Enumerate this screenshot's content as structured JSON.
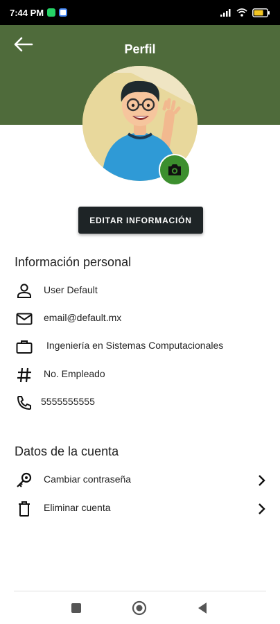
{
  "status_bar": {
    "time": "7:44 PM",
    "battery": "65"
  },
  "header": {
    "title": "Perfil",
    "color": "#4f6b3b"
  },
  "profile": {
    "edit_label": "EDITAR INFORMACIÓN",
    "camera_color": "#3c8f2e"
  },
  "personal": {
    "title": "Información personal",
    "items": [
      {
        "icon": "person-icon",
        "label": "User Default"
      },
      {
        "icon": "mail-icon",
        "label": "email@default.mx"
      },
      {
        "icon": "briefcase-icon",
        "label": "Ingeniería en Sistemas Computacionales"
      },
      {
        "icon": "hash-icon",
        "label": "No. Empleado"
      },
      {
        "icon": "phone-icon",
        "label": "5555555555"
      }
    ]
  },
  "account": {
    "title": "Datos de la cuenta",
    "items": [
      {
        "icon": "key-icon",
        "label": "Cambiar contraseña"
      },
      {
        "icon": "trash-icon",
        "label": "Eliminar cuenta"
      }
    ]
  },
  "nav": {
    "buttons": [
      "recent-apps",
      "home",
      "back"
    ]
  }
}
